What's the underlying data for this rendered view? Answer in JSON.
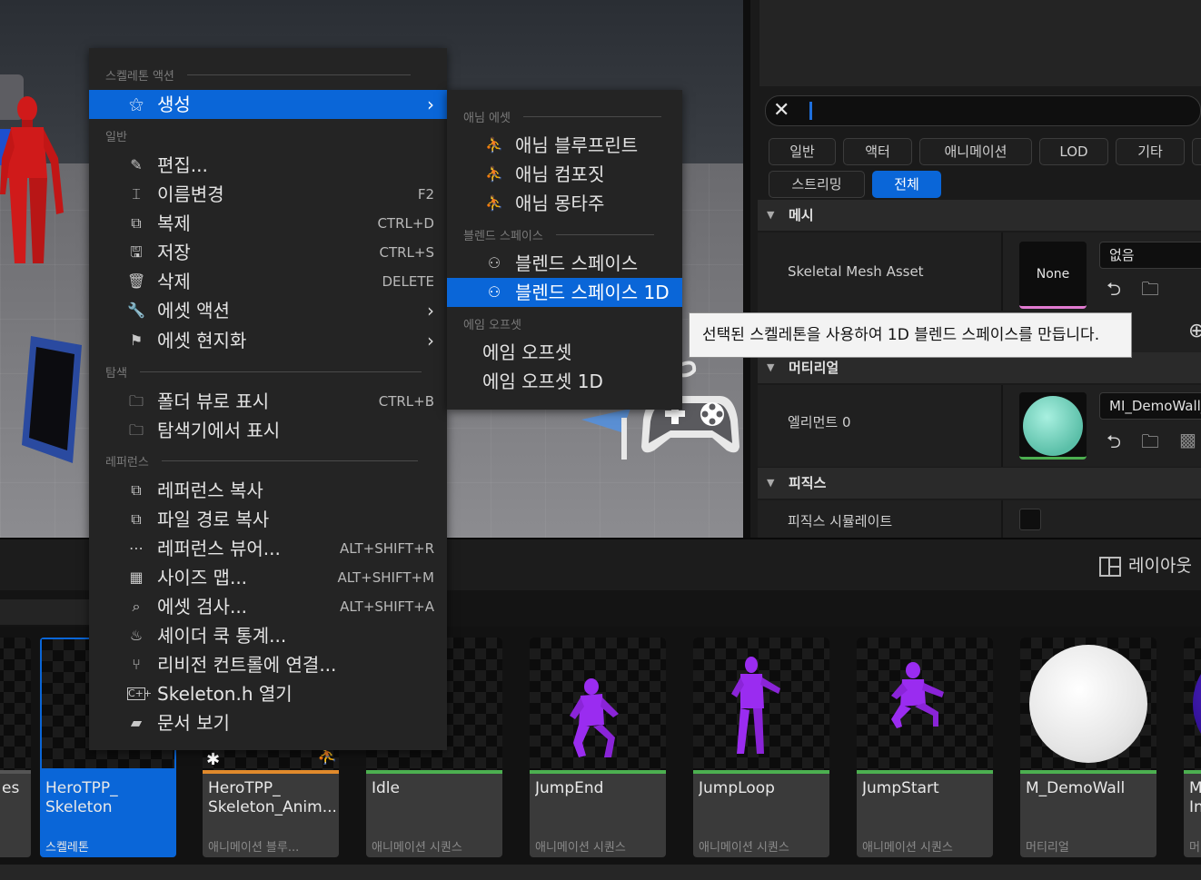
{
  "context_menu": {
    "sections": {
      "skeleton_actions": "스켈레톤 액션",
      "common": "일반",
      "explore": "탐색",
      "references": "레퍼런스"
    },
    "create": "생성",
    "edit": "편집...",
    "rename": {
      "label": "이름변경",
      "shortcut": "F2"
    },
    "duplicate": {
      "label": "복제",
      "shortcut": "CTRL+D"
    },
    "save": {
      "label": "저장",
      "shortcut": "CTRL+S"
    },
    "delete": {
      "label": "삭제",
      "shortcut": "DELETE"
    },
    "asset_actions": "에셋 액션",
    "asset_localization": "에셋 현지화",
    "show_in_folder_view": {
      "label": "폴더 뷰로 표시",
      "shortcut": "CTRL+B"
    },
    "show_in_explorer": "탐색기에서 표시",
    "copy_reference": "레퍼런스 복사",
    "copy_file_path": "파일 경로 복사",
    "reference_viewer": {
      "label": "레퍼런스 뷰어...",
      "shortcut": "ALT+SHIFT+R"
    },
    "size_map": {
      "label": "사이즈 맵...",
      "shortcut": "ALT+SHIFT+M"
    },
    "audit_assets": {
      "label": "에셋 검사...",
      "shortcut": "ALT+SHIFT+A"
    },
    "shader_cook_stats": "셰이더 쿡 통계...",
    "connect_source_control": "리비전 컨트롤에 연결...",
    "open_header": "Skeleton.h 열기",
    "view_documentation": "문서 보기"
  },
  "submenu": {
    "sections": {
      "anim_asset": "애님 에셋",
      "blend_space": "블렌드 스페이스",
      "aim_offset": "에임 오프셋"
    },
    "anim_blueprint": "애님 블루프린트",
    "anim_composite": "애님 컴포짓",
    "anim_montage": "애님 몽타주",
    "blend_space": "블렌드 스페이스",
    "blend_space_1d": "블렌드 스페이스 1D",
    "aim_offset": "에임 오프셋",
    "aim_offset_1d": "에임 오프셋 1D"
  },
  "tooltip": "선택된 스켈레톤을 사용하여 1D 블렌드 스페이스를 만듭니다.",
  "details": {
    "search_close": "✕",
    "filter_tabs": [
      "일반",
      "액터",
      "애니메이션",
      "LOD",
      "기타",
      "스트리밍",
      "전체"
    ],
    "sections": {
      "mesh": "메시",
      "material": "머티리얼",
      "physics": "피직스"
    },
    "skeletal_mesh_label": "Skeletal Mesh Asset",
    "skeletal_mesh_thumb": "None",
    "skeletal_mesh_value": "없음",
    "element0_label": "엘리먼트 0",
    "element0_value": "MI_DemoWall_",
    "simulate_physics_label": "피직스 시뮬레이트",
    "simulate_physics_checked": false
  },
  "layout_button": "레이아웃",
  "assets": [
    {
      "name": "es",
      "type": ""
    },
    {
      "name": "HeroTPP_\nSkeleton",
      "type": "스켈레톤",
      "selected": true
    },
    {
      "name": "HeroTPP_\nSkeleton_Anim...\nBlueprint",
      "type": "애니메이션 블루..."
    },
    {
      "name": "Idle",
      "type": "애니메이션 시퀀스"
    },
    {
      "name": "JumpEnd",
      "type": "애니메이션 시퀀스"
    },
    {
      "name": "JumpLoop",
      "type": "애니메이션 시퀀스"
    },
    {
      "name": "JumpStart",
      "type": "애니메이션 시퀀스"
    },
    {
      "name": "M_DemoWall",
      "type": "머티리얼"
    },
    {
      "name": "M\nIn",
      "type": "머"
    }
  ],
  "colors": {
    "accent": "#0a66d8",
    "anim_sequence_bar": "#4caf50",
    "anim_blueprint_bar": "#e08a2c",
    "material_bar": "#4caf50",
    "mannequin_red": "#d01a1a",
    "mannequin_purple": "#9a2cf0"
  }
}
